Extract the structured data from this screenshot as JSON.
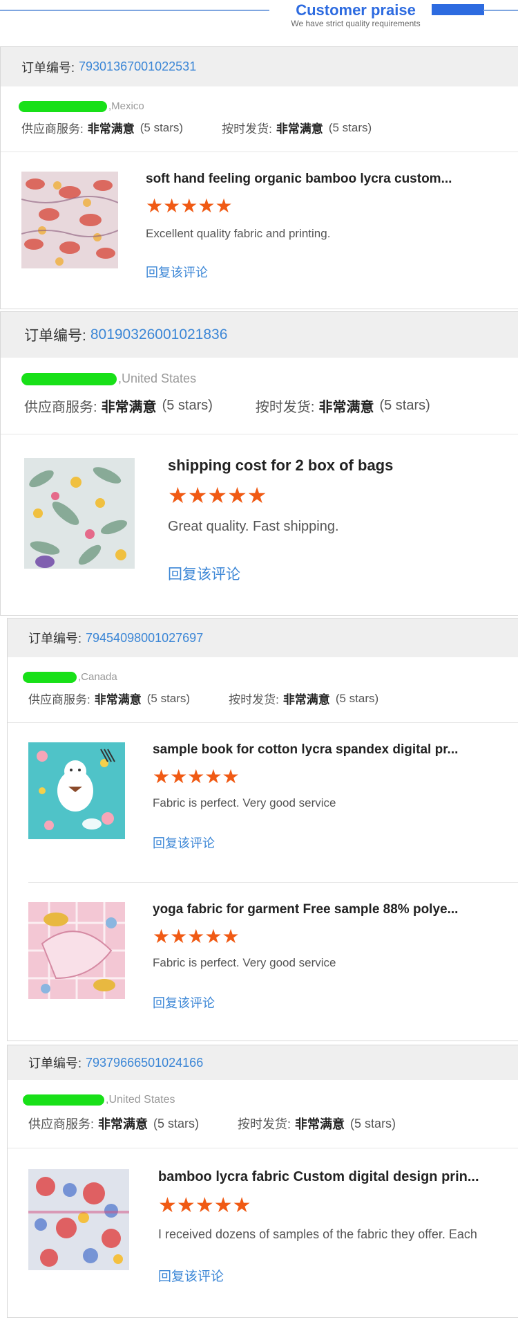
{
  "header": {
    "title": "Customer praise",
    "subtitle": "We have strict quality requirements"
  },
  "labels": {
    "order_no": "订单编号:",
    "supplier_service": "供应商服务:",
    "on_time_delivery": "按时发货:",
    "rating_value": "非常满意",
    "stars_text": "(5 stars)",
    "reply": "回复该评论"
  },
  "colors": {
    "accent": "#2d6be0",
    "link": "#3b86d6",
    "star": "#f05a14",
    "mask": "#18e018"
  },
  "cards": [
    {
      "order_number": "79301367001022531",
      "country": ",Mexico",
      "items": [
        {
          "title": "soft hand feeling organic bamboo lycra custom...",
          "stars": 5,
          "comment": "Excellent quality fabric and printing."
        }
      ]
    },
    {
      "order_number": "80190326001021836",
      "country": ",United States",
      "items": [
        {
          "title": "shipping cost for 2 box of bags",
          "stars": 5,
          "comment": "Great quality. Fast shipping."
        }
      ]
    },
    {
      "order_number": "79454098001027697",
      "country": ",Canada",
      "items": [
        {
          "title": "sample book for cotton lycra spandex digital pr...",
          "stars": 5,
          "comment": "Fabric is perfect. Very good service"
        },
        {
          "title": "yoga fabric for garment Free sample 88% polye...",
          "stars": 5,
          "comment": "Fabric is perfect. Very good service"
        }
      ]
    },
    {
      "order_number": "79379666501024166",
      "country": ",United States",
      "items": [
        {
          "title": "bamboo lycra fabric Custom digital design prin...",
          "stars": 5,
          "comment": "I received dozens of samples of the fabric they offer.  Each"
        }
      ]
    }
  ]
}
